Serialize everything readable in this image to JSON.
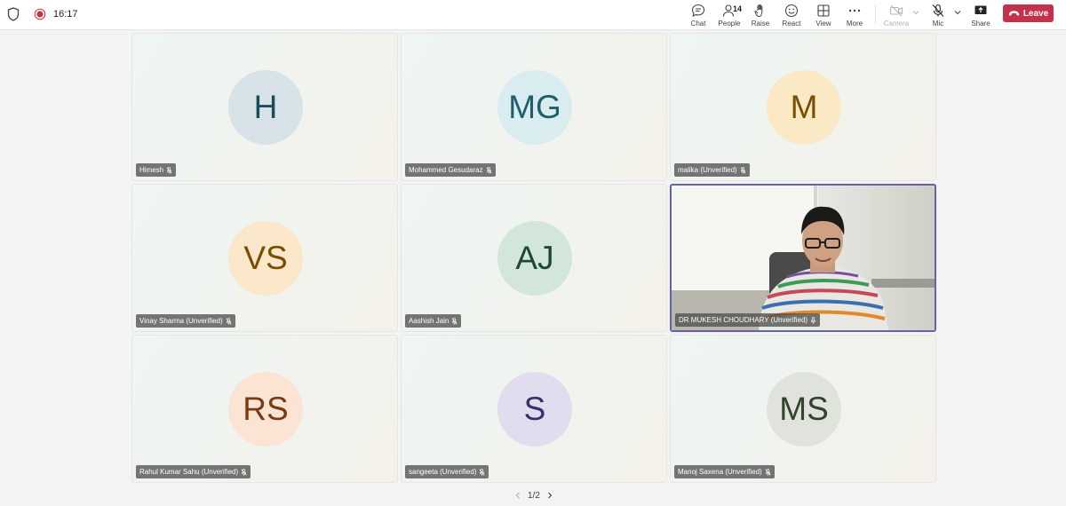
{
  "status": {
    "time": "16:17"
  },
  "toolbar": {
    "chat": "Chat",
    "people": "People",
    "people_count": "14",
    "raise": "Raise",
    "react": "React",
    "view": "View",
    "more": "More",
    "camera": "Camera",
    "mic": "Mic",
    "share": "Share",
    "leave": "Leave"
  },
  "participants": [
    {
      "initials": "H",
      "name": "Himesh",
      "bg": "#d7e3e8",
      "fg": "#1f4a5c"
    },
    {
      "initials": "MG",
      "name": "Mohammed Gesudaraz",
      "bg": "#d9edf0",
      "fg": "#1f5f6a"
    },
    {
      "initials": "M",
      "name": "malika (Unverified)",
      "bg": "#fbe9c6",
      "fg": "#7a4d00"
    },
    {
      "initials": "VS",
      "name": "Vinay Sharma (Unverified)",
      "bg": "#fbe7c9",
      "fg": "#7a4d00"
    },
    {
      "initials": "AJ",
      "name": "Aashish Jain",
      "bg": "#d3e6dc",
      "fg": "#1e4a33"
    },
    {
      "initials": "",
      "name": "DR MUKESH CHOUDHARY (Unverified)",
      "bg": "",
      "fg": ""
    },
    {
      "initials": "RS",
      "name": "Rahul Kumar Sahu (Unverified)",
      "bg": "#fce4d4",
      "fg": "#7a3a12"
    },
    {
      "initials": "S",
      "name": "sangeeta (Unverified)",
      "bg": "#e2dcef",
      "fg": "#3c2f6e"
    },
    {
      "initials": "MS",
      "name": "Manoj Saxena (Unverified)",
      "bg": "#dfe3dc",
      "fg": "#34432c"
    }
  ],
  "pager": {
    "label": "1/2"
  },
  "colors": {
    "leave": "#c4314b",
    "active_border": "#6264a7"
  }
}
